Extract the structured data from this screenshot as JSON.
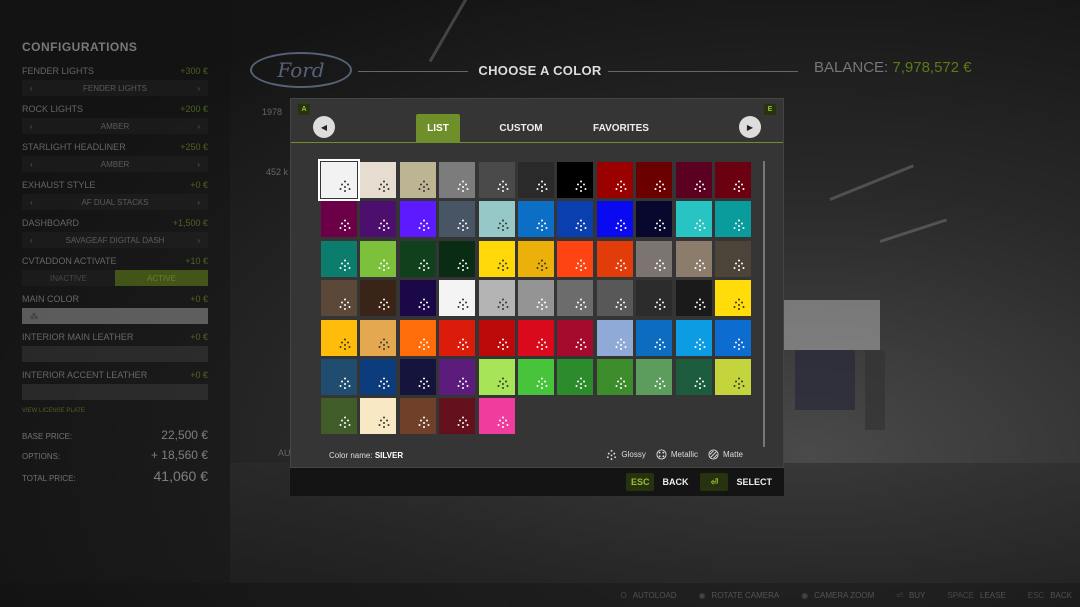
{
  "sidebar": {
    "title": "CONFIGURATIONS",
    "configs": [
      {
        "label": "FENDER LIGHTS",
        "price": "+300 €",
        "value": "FENDER LIGHTS"
      },
      {
        "label": "ROCK LIGHTS",
        "price": "+200 €",
        "value": "AMBER"
      },
      {
        "label": "STARLIGHT HEADLINER",
        "price": "+250 €",
        "value": "AMBER"
      },
      {
        "label": "EXHAUST STYLE",
        "price": "+0 €",
        "value": "AF DUAL STACKS"
      },
      {
        "label": "DASHBOARD",
        "price": "+1,500 €",
        "value": "SAVAGEAF DIGITAL DASH"
      }
    ],
    "cvt": {
      "label": "CVTADDON ACTIVATE",
      "price": "+10 €",
      "inactive": "INACTIVE",
      "active": "ACTIVE"
    },
    "main_color": {
      "label": "MAIN COLOR",
      "price": "+0 €"
    },
    "interior_main": {
      "label": "INTERIOR MAIN LEATHER",
      "price": "+0 €"
    },
    "interior_accent": {
      "label": "INTERIOR ACCENT LEATHER",
      "price": "+0 €"
    },
    "small_note": "VIEW LICENSE PLATE",
    "base_price_label": "BASE PRICE:",
    "base_price": "22,500 €",
    "options_label": "OPTIONS:",
    "options": "+ 18,560 €",
    "total_label": "TOTAL PRICE:",
    "total": "41,060 €"
  },
  "header": {
    "brand_logo": "Ford",
    "title": "CHOOSE A COLOR",
    "balance_label": "BALANCE:",
    "balance": "7,978,572 €",
    "bg_text_1": "1978",
    "bg_text_2": "452 k",
    "bg_text_3": "AU"
  },
  "dialog": {
    "key_left": "A",
    "key_right": "E",
    "tabs": [
      "LIST",
      "CUSTOM",
      "FAVORITES"
    ],
    "active_tab": "LIST",
    "colorname_label": "Color name:",
    "colorname": "SILVER",
    "legend": {
      "glossy": "Glossy",
      "metallic": "Metallic",
      "matte": "Matte"
    },
    "swatches": [
      "#f2f2f2",
      "#e6ddd0",
      "#bdb494",
      "#7c7c7c",
      "#4a4a4a",
      "#2a2a2a",
      "#000000",
      "#9b0000",
      "#6a0000",
      "#5c0022",
      "#6b0010",
      "#6b0048",
      "#4d0f6e",
      "#5d1aff",
      "#475565",
      "#96c8c8",
      "#0c6ec4",
      "#0a3fb0",
      "#0a0af0",
      "#08082e",
      "#28c4c4",
      "#0a9c9c",
      "#0c7c6c",
      "#7cc03c",
      "#10401c",
      "#0a2c14",
      "#ffd80a",
      "#ecb00a",
      "#ff4414",
      "#e23c0a",
      "#7c7470",
      "#8c7c6c",
      "#4c4438",
      "#5c4838",
      "#3a2418",
      "#1a0848",
      "#f4f4f4",
      "#b4b4b4",
      "#949494",
      "#6c6c6c",
      "#585858",
      "#2c2c2c",
      "#1a1a1a",
      "#ffdc0a",
      "#ffbc0a",
      "#e4a850",
      "#ff6c0a",
      "#dc1c0a",
      "#bc0a0a",
      "#d80a1c",
      "#a40a2c",
      "#90aad8",
      "#0c6cc0",
      "#0c9ce4",
      "#0c6cd0",
      "#204c70",
      "#0c3c7c",
      "#14143c",
      "#5c1c7c",
      "#a8e458",
      "#48c43c",
      "#2c8c2c",
      "#3c8c2c",
      "#5c9c5c",
      "#1c5c3c",
      "#c4d43c",
      "#405c28",
      "#f8e8c4",
      "#704028",
      "#64101c",
      "#f03c9c"
    ],
    "selected_index": 0,
    "back_key": "ESC",
    "back_label": "BACK",
    "select_label": "SELECT"
  },
  "bottom": {
    "items": [
      {
        "key": "O",
        "label": "AUTOLOAD"
      },
      {
        "key": "",
        "label": "ROTATE CAMERA"
      },
      {
        "key": "",
        "label": "CAMERA ZOOM"
      },
      {
        "key": "",
        "label": "BUY"
      },
      {
        "key": "SPACE",
        "label": "LEASE"
      },
      {
        "key": "ESC",
        "label": "BACK"
      }
    ]
  },
  "colors": {
    "accent": "#6e8f2a",
    "dialog_bg": "#353535"
  }
}
